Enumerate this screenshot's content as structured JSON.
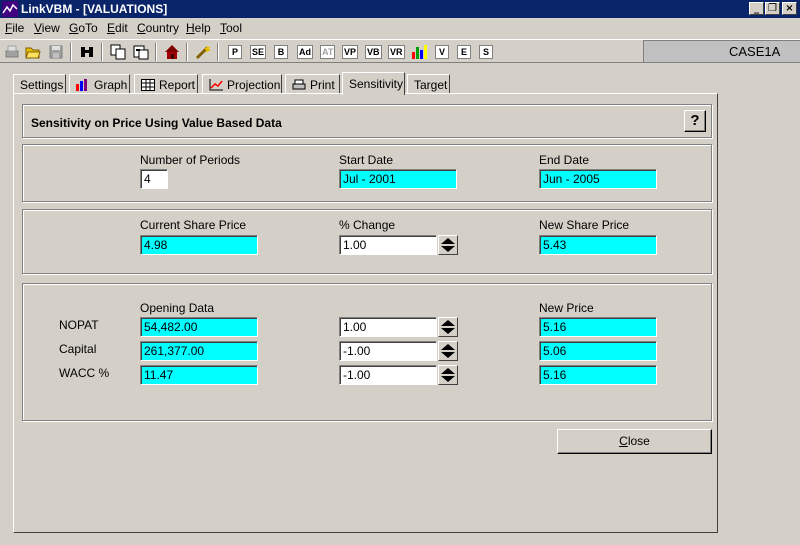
{
  "window": {
    "title": "LinkVBM - [VALUATIONS]"
  },
  "menu": {
    "items": [
      {
        "pre": "",
        "hot": "F",
        "post": "ile"
      },
      {
        "pre": "",
        "hot": "V",
        "post": "iew"
      },
      {
        "pre": "",
        "hot": "G",
        "post": "oTo"
      },
      {
        "pre": "",
        "hot": "E",
        "post": "dit"
      },
      {
        "pre": "",
        "hot": "C",
        "post": "ountry"
      },
      {
        "pre": "",
        "hot": "H",
        "post": "elp"
      },
      {
        "pre": "",
        "hot": "T",
        "post": "ool"
      }
    ]
  },
  "toolbar": {
    "letter_buttons": [
      "P",
      "SE",
      "B",
      "Ad",
      "AT",
      "VP",
      "VB",
      "VR",
      "V",
      "E",
      "S"
    ],
    "case_label": "CASE1A"
  },
  "tabs": {
    "settings": "Settings",
    "graph": "Graph",
    "report": "Report",
    "projection": "Projection",
    "print": "Print",
    "sensitivity": "Sensitivity",
    "target": "Target",
    "active": "sensitivity"
  },
  "header": {
    "title": "Sensitivity on Price Using Value Based Data",
    "help_label": "?"
  },
  "periods": {
    "num_periods_label": "Number of Periods",
    "num_periods_value": "4",
    "start_date_label": "Start Date",
    "start_date_value": "Jul - 2001",
    "end_date_label": "End Date",
    "end_date_value": "Jun - 2005"
  },
  "share_price": {
    "current_label": "Current Share Price",
    "current_value": "4.98",
    "change_label": "% Change",
    "change_value": "1.00",
    "new_label": "New Share Price",
    "new_value": "5.43"
  },
  "drivers": {
    "opening_label": "Opening Data",
    "new_price_label": "New Price",
    "rows": [
      {
        "label": "NOPAT",
        "opening": "54,482.00",
        "change": "1.00",
        "new_price": "5.16"
      },
      {
        "label": "Capital",
        "opening": "261,377.00",
        "change": "-1.00",
        "new_price": "5.06"
      },
      {
        "label": "WACC %",
        "opening": "11.47",
        "change": "-1.00",
        "new_price": "5.16"
      }
    ]
  },
  "buttons": {
    "close_hot": "C",
    "close_rest": "lose"
  },
  "colors": {
    "titlebar": "#0a246a",
    "face": "#d4d0c8",
    "computed_field": "#00ffff"
  }
}
